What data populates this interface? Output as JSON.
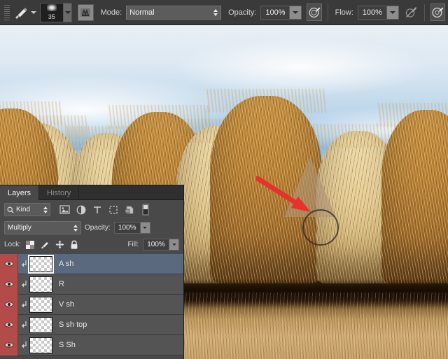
{
  "options_bar": {
    "gripper": "drag-gripper",
    "tool_icon": "brush-tool-icon",
    "tool_preset_caret": "chevron-down-icon",
    "brush_size": "35",
    "brush_preview_icon": "soft-round-brush-preview",
    "brush_panel_icon": "brush-panel-toggle-icon",
    "mode_label": "Mode:",
    "mode_value": "Normal",
    "opacity_label": "Opacity:",
    "opacity_value": "100%",
    "opacity_pressure_icon": "pressure-opacity-icon",
    "flow_label": "Flow:",
    "flow_value": "100%",
    "flow_pressure_icon": "pressure-size-disabled-icon",
    "airbrush_icon": "airbrush-icon"
  },
  "canvas": {
    "annotation_arrow_color": "#e8312a",
    "annotation_circle_color": "#2a241e",
    "triangle_fill": "#b29676"
  },
  "layers_panel": {
    "tabs": [
      {
        "label": "Layers",
        "active": true
      },
      {
        "label": "History",
        "active": false
      }
    ],
    "filter": {
      "search_icon": "magnifier-icon",
      "kind_value": "Kind",
      "icons": [
        "filter-pixel-layers-icon",
        "filter-adjustment-layers-icon",
        "filter-type-layers-icon",
        "filter-shape-layers-icon",
        "filter-smart-object-icon",
        "filter-toggle-switch-icon"
      ]
    },
    "blend": {
      "mode_value": "Multiply",
      "opacity_label": "Opacity:",
      "opacity_value": "100%"
    },
    "lock": {
      "label": "Lock:",
      "icons": [
        "lock-transparency-icon",
        "lock-image-pixels-icon",
        "lock-position-icon",
        "lock-all-icon"
      ],
      "fill_label": "Fill:",
      "fill_value": "100%"
    },
    "layers": [
      {
        "name": "A sh",
        "visible": true,
        "clipped": true,
        "selected": true
      },
      {
        "name": "R",
        "visible": true,
        "clipped": true,
        "selected": false
      },
      {
        "name": "V sh",
        "visible": true,
        "clipped": true,
        "selected": false
      },
      {
        "name": "S sh top",
        "visible": true,
        "clipped": true,
        "selected": false
      },
      {
        "name": "S Sh",
        "visible": true,
        "clipped": true,
        "selected": false
      }
    ],
    "colors": {
      "selected_row": "#5a697e",
      "row": "#545454",
      "eye_column": "#b44b4b",
      "panel_bg": "#494949"
    }
  }
}
